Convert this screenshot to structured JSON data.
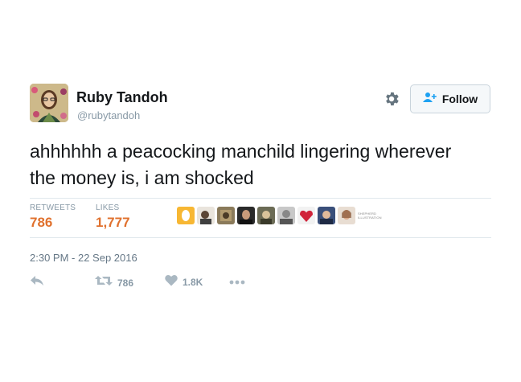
{
  "user": {
    "name": "Ruby Tandoh",
    "handle": "@rubytandoh"
  },
  "follow_label": "Follow",
  "tweet_text": "ahhhhhh a peacocking manchild lingering wherever the money is, i am shocked",
  "stats": {
    "retweets_label": "RETWEETS",
    "retweets_value": "786",
    "likes_label": "LIKES",
    "likes_value": "1,777"
  },
  "likers_logo": {
    "line1": "SHEPHERD",
    "line2": "ILLUSTRATION"
  },
  "timestamp": "2:30 PM - 22 Sep 2016",
  "actions": {
    "retweet_count": "786",
    "like_count": "1.8K"
  },
  "colors": {
    "text": "#14171a",
    "muted": "#8899a6",
    "stat_value": "#e0712e",
    "divider": "#e1e8ed"
  }
}
